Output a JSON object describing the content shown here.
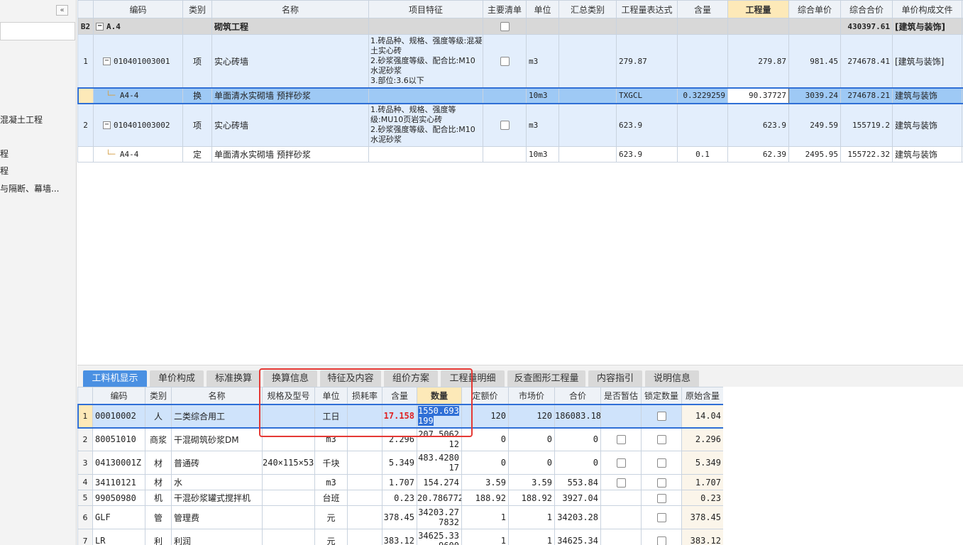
{
  "left_panel": {
    "collapse_label": "«",
    "tree_items": [
      "混凝土工程",
      "程",
      "程",
      "与隔断、幕墙..."
    ]
  },
  "top_grid": {
    "headers": [
      "编码",
      "类别",
      "名称",
      "项目特征",
      "主要清单",
      "单位",
      "汇总类别",
      "工程量表达式",
      "含量",
      "工程量",
      "综合单价",
      "综合合价",
      "单价构成文件"
    ],
    "rows": [
      {
        "rownum": "B2",
        "code": "A.4",
        "type": "",
        "name": "砌筑工程",
        "feature": "",
        "unit": "",
        "summary": "",
        "expr": "",
        "content": "",
        "qty": "",
        "unit_price": "",
        "total": "430397.61",
        "file": "[建筑与装饰]"
      },
      {
        "rownum": "1",
        "code": "010401003001",
        "type": "项",
        "name": "实心砖墙",
        "feature": "1.砖品种、规格、强度等级:混凝土实心砖\n2.砂浆强度等级、配合比:M10水泥砂浆\n3.部位:3.6以下",
        "unit": "m3",
        "summary": "",
        "expr": "279.87",
        "content": "",
        "qty": "279.87",
        "unit_price": "981.45",
        "total": "274678.41",
        "file": "[建筑与装饰]"
      },
      {
        "rownum": "",
        "code": "A4-4",
        "type": "换",
        "name": "单面清水实砌墙 预拌砂浆",
        "feature": "",
        "unit": "10m3",
        "summary": "",
        "expr": "TXGCL",
        "content": "0.3229259",
        "qty": "90.37727",
        "unit_price": "3039.24",
        "total": "274678.21",
        "file": "建筑与装饰"
      },
      {
        "rownum": "2",
        "code": "010401003002",
        "type": "项",
        "name": "实心砖墙",
        "feature": "1.砖品种、规格、强度等级:MU10页岩实心砖\n2.砂浆强度等级、配合比:M10水泥砂浆",
        "unit": "m3",
        "summary": "",
        "expr": "623.9",
        "content": "",
        "qty": "623.9",
        "unit_price": "249.59",
        "total": "155719.2",
        "file": "建筑与装饰"
      },
      {
        "rownum": "",
        "code": "A4-4",
        "type": "定",
        "name": "单面清水实砌墙 预拌砂浆",
        "feature": "",
        "unit": "10m3",
        "summary": "",
        "expr": "623.9",
        "content": "0.1",
        "qty": "62.39",
        "unit_price": "2495.95",
        "total": "155722.32",
        "file": "建筑与装饰"
      }
    ]
  },
  "tabs": [
    "工料机显示",
    "单价构成",
    "标准换算",
    "换算信息",
    "特征及内容",
    "组价方案",
    "工程量明细",
    "反查图形工程量",
    "内容指引",
    "说明信息"
  ],
  "bottom_grid": {
    "headers": [
      "",
      "编码",
      "类别",
      "名称",
      "规格及型号",
      "单位",
      "损耗率",
      "含量",
      "数量",
      "定额价",
      "市场价",
      "合价",
      "是否暂估",
      "锁定数量",
      "原始含量"
    ],
    "rows": [
      {
        "n": "1",
        "code": "00010002",
        "type": "人",
        "name": "二类综合用工",
        "spec": "",
        "unit": "工日",
        "loss": "",
        "content": "17.158",
        "qty": "1550.693199",
        "quota": "120",
        "market": "120",
        "total": "186083.18",
        "original": "14.04"
      },
      {
        "n": "2",
        "code": "80051010",
        "type": "商浆",
        "name": "干混砌筑砂浆DM",
        "spec": "",
        "unit": "m3",
        "loss": "",
        "content": "2.296",
        "qty": "207.506212",
        "quota": "0",
        "market": "0",
        "total": "0",
        "original": "2.296"
      },
      {
        "n": "3",
        "code": "04130001Z",
        "type": "材",
        "name": "普通砖",
        "spec": "240×115×53",
        "unit": "千块",
        "loss": "",
        "content": "5.349",
        "qty": "483.428017",
        "quota": "0",
        "market": "0",
        "total": "0",
        "original": "5.349"
      },
      {
        "n": "4",
        "code": "34110121",
        "type": "材",
        "name": "水",
        "spec": "",
        "unit": "m3",
        "loss": "",
        "content": "1.707",
        "qty": "154.274",
        "quota": "3.59",
        "market": "3.59",
        "total": "553.84",
        "original": "1.707"
      },
      {
        "n": "5",
        "code": "99050980",
        "type": "机",
        "name": "干混砂浆罐式搅拌机",
        "spec": "",
        "unit": "台班",
        "loss": "",
        "content": "0.23",
        "qty": "20.786772",
        "quota": "188.92",
        "market": "188.92",
        "total": "3927.04",
        "original": "0.23"
      },
      {
        "n": "6",
        "code": "GLF",
        "type": "管",
        "name": "管理费",
        "spec": "",
        "unit": "元",
        "loss": "",
        "content": "378.45",
        "qty": "34203.277832",
        "quota": "1",
        "market": "1",
        "total": "34203.28",
        "original": "378.45"
      },
      {
        "n": "7",
        "code": "LR",
        "type": "利",
        "name": "利润",
        "spec": "",
        "unit": "元",
        "loss": "",
        "content": "383.12",
        "qty": "34625.339600",
        "quota": "1",
        "market": "1",
        "total": "34625.34",
        "original": "383.12"
      }
    ]
  },
  "colors": {
    "accent": "#4a90e2",
    "selection": "#9ec9f5",
    "highlight_header": "#fde9b8",
    "annotation": "#e53935"
  }
}
